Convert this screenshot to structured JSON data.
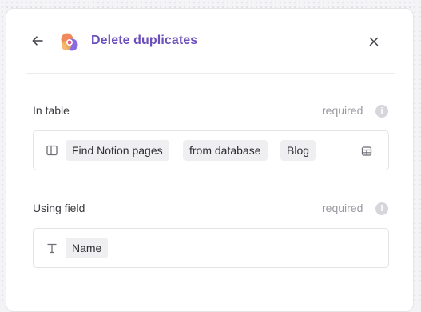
{
  "header": {
    "title": "Delete duplicates",
    "back_icon": "arrow-left-icon",
    "close_icon": "close-icon",
    "logo": "app-logo"
  },
  "fields": [
    {
      "label": "In table",
      "required_text": "required",
      "info_icon": "info-icon",
      "leading_icon": "columns-icon",
      "chips": [
        "Find Notion pages",
        "from database",
        "Blog"
      ],
      "trailing_icon": "table-icon"
    },
    {
      "label": "Using field",
      "required_text": "required",
      "info_icon": "info-icon",
      "leading_icon": "text-type-icon",
      "chips": [
        "Name"
      ]
    }
  ],
  "colors": {
    "title": "#6b4fbb",
    "label": "#3a3a40",
    "muted": "#9a9aa2",
    "chip_bg": "#efeff1"
  }
}
